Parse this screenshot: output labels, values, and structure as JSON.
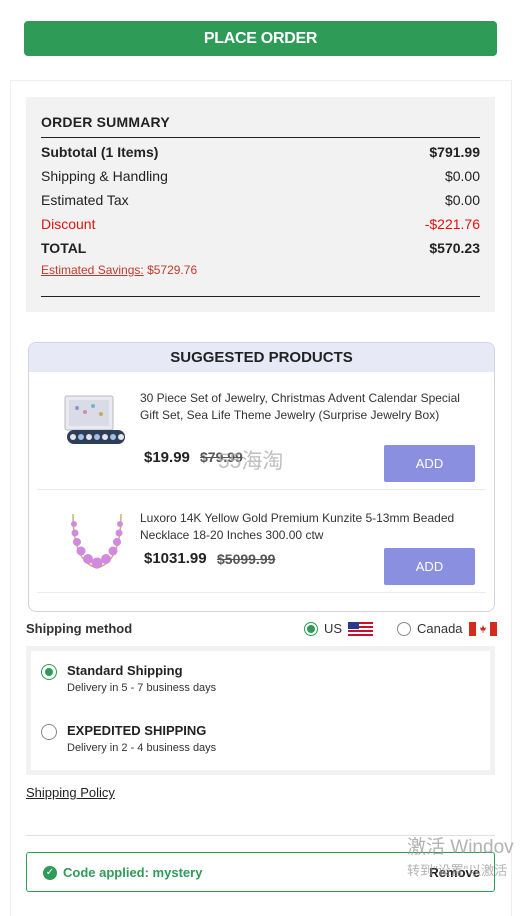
{
  "place_order_label": "PLACE ORDER",
  "summary": {
    "title": "ORDER SUMMARY",
    "rows": [
      {
        "label": "Subtotal (1 Items)",
        "value": "$791.99",
        "style": "bold"
      },
      {
        "label": "Shipping & Handling",
        "value": "$0.00",
        "style": "normal"
      },
      {
        "label": "Estimated Tax",
        "value": "$0.00",
        "style": "normal"
      },
      {
        "label": "Discount",
        "value": "-$221.76",
        "style": "red"
      },
      {
        "label": "TOTAL",
        "value": "$570.23",
        "style": "bold"
      }
    ],
    "savings_label": "Estimated Savings:",
    "savings_value": "$5729.76"
  },
  "suggested": {
    "title": "SUGGESTED PRODUCTS",
    "products": [
      {
        "name": "30 Piece Set of Jewelry, Christmas Advent Calendar Special Gift Set, Sea Life Theme Jewelry (Surprise Jewelry Box)",
        "price": "$19.99",
        "old_price": "$79.99",
        "add_label": "ADD",
        "image": "jewelry-box-image"
      },
      {
        "name": "Luxoro 14K Yellow Gold Premium Kunzite 5-13mm Beaded Necklace 18-20 Inches 300.00 ctw",
        "price": "$1031.99",
        "old_price": "$5099.99",
        "add_label": "ADD",
        "image": "pink-necklace-image"
      }
    ]
  },
  "shipping": {
    "label": "Shipping method",
    "countries": [
      {
        "name": "US",
        "selected": true,
        "flag": "us-flag-icon"
      },
      {
        "name": "Canada",
        "selected": false,
        "flag": "canada-flag-icon"
      }
    ],
    "methods": [
      {
        "title": "Standard Shipping",
        "sub": "Delivery in 5 - 7 business days",
        "selected": true
      },
      {
        "title": "EXPEDITED SHIPPING",
        "sub": "Delivery in 2 - 4 business days",
        "selected": false
      }
    ],
    "policy_label": "Shipping Policy"
  },
  "coupon": {
    "text": "Code applied: mystery",
    "remove_label": "Remove"
  },
  "watermarks": {
    "site": "55海淘",
    "windows_line1": "激活 Windov",
    "windows_line2": "转到\"设置\"以激活"
  },
  "colors": {
    "accent_green": "#2e9b57",
    "add_button": "#8a8fe0",
    "discount_red": "#e0140f"
  }
}
